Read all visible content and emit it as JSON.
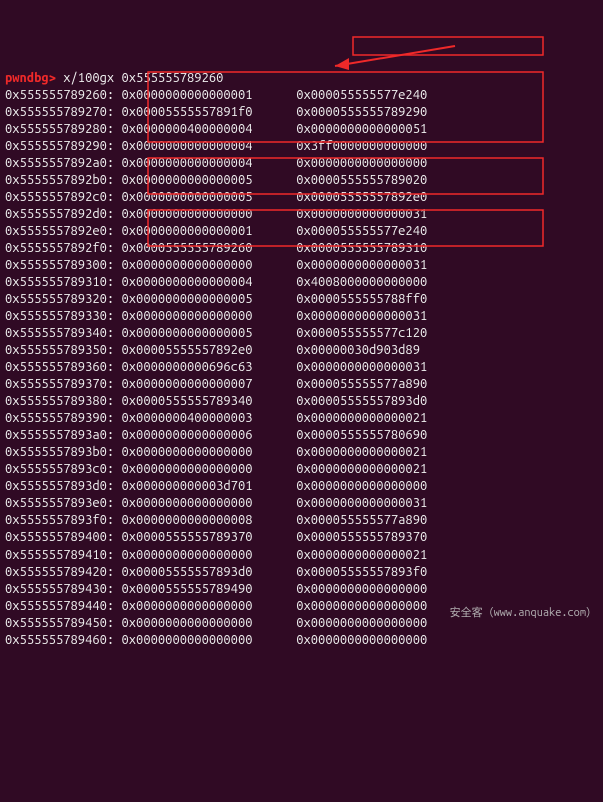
{
  "prompt": {
    "name": "pwndbg",
    "arrow": ">",
    "command": "x/100gx 0x555555789260"
  },
  "rows": [
    {
      "addr": "0x555555789260:",
      "v1": "0x0000000000000001",
      "v2": "0x000055555577e240"
    },
    {
      "addr": "0x555555789270:",
      "v1": "0x00005555557891f0",
      "v2": "0x0000555555789290"
    },
    {
      "addr": "0x555555789280:",
      "v1": "0x0000000400000004",
      "v2": "0x0000000000000051"
    },
    {
      "addr": "0x555555789290:",
      "v1": "0x0000000000000004",
      "v2": "0x3ff0000000000000"
    },
    {
      "addr": "0x5555557892a0:",
      "v1": "0x0000000000000004",
      "v2": "0x0000000000000000"
    },
    {
      "addr": "0x5555557892b0:",
      "v1": "0x0000000000000005",
      "v2": "0x0000555555789020"
    },
    {
      "addr": "0x5555557892c0:",
      "v1": "0x0000000000000005",
      "v2": "0x00005555557892e0"
    },
    {
      "addr": "0x5555557892d0:",
      "v1": "0x0000000000000000",
      "v2": "0x0000000000000031"
    },
    {
      "addr": "0x5555557892e0:",
      "v1": "0x0000000000000001",
      "v2": "0x000055555577e240"
    },
    {
      "addr": "0x5555557892f0:",
      "v1": "0x0000555555789260",
      "v2": "0x0000555555789310"
    },
    {
      "addr": "0x555555789300:",
      "v1": "0x0000000000000000",
      "v2": "0x0000000000000031"
    },
    {
      "addr": "0x555555789310:",
      "v1": "0x0000000000000004",
      "v2": "0x4008000000000000"
    },
    {
      "addr": "0x555555789320:",
      "v1": "0x0000000000000005",
      "v2": "0x0000555555788ff0"
    },
    {
      "addr": "0x555555789330:",
      "v1": "0x0000000000000000",
      "v2": "0x0000000000000031"
    },
    {
      "addr": "0x555555789340:",
      "v1": "0x0000000000000005",
      "v2": "0x000055555577c120"
    },
    {
      "addr": "0x555555789350:",
      "v1": "0x00005555557892e0",
      "v2": "0x00000030d903d89"
    },
    {
      "addr": "0x555555789360:",
      "v1": "0x0000000000696c63",
      "v2": "0x0000000000000031"
    },
    {
      "addr": "0x555555789370:",
      "v1": "0x0000000000000007",
      "v2": "0x000055555577a890"
    },
    {
      "addr": "0x555555789380:",
      "v1": "0x0000555555789340",
      "v2": "0x00005555557893d0"
    },
    {
      "addr": "0x555555789390:",
      "v1": "0x0000000400000003",
      "v2": "0x0000000000000021"
    },
    {
      "addr": "0x5555557893a0:",
      "v1": "0x0000000000000006",
      "v2": "0x0000555555780690"
    },
    {
      "addr": "0x5555557893b0:",
      "v1": "0x0000000000000000",
      "v2": "0x0000000000000021"
    },
    {
      "addr": "0x5555557893c0:",
      "v1": "0x0000000000000000",
      "v2": "0x0000000000000021"
    },
    {
      "addr": "0x5555557893d0:",
      "v1": "0x000000000003d701",
      "v2": "0x0000000000000000"
    },
    {
      "addr": "0x5555557893e0:",
      "v1": "0x0000000000000000",
      "v2": "0x0000000000000031"
    },
    {
      "addr": "0x5555557893f0:",
      "v1": "0x0000000000000008",
      "v2": "0x000055555577a890"
    },
    {
      "addr": "0x555555789400:",
      "v1": "0x0000555555789370",
      "v2": "0x0000555555789370"
    },
    {
      "addr": "0x555555789410:",
      "v1": "0x0000000000000000",
      "v2": "0x0000000000000021"
    },
    {
      "addr": "0x555555789420:",
      "v1": "0x00005555557893d0",
      "v2": "0x00005555557893f0"
    },
    {
      "addr": "0x555555789430:",
      "v1": "0x0000555555789490",
      "v2": "0x0000000000000000"
    },
    {
      "addr": "0x555555789440:",
      "v1": "0x0000000000000000",
      "v2": "0x0000000000000000"
    },
    {
      "addr": "0x555555789450:",
      "v1": "0x0000000000000000",
      "v2": "0x0000000000000000"
    },
    {
      "addr": "0x555555789460:",
      "v1": "0x0000000000000000",
      "v2": "0x0000000000000000"
    }
  ],
  "watermark": "安全客（www.anquake.com）"
}
